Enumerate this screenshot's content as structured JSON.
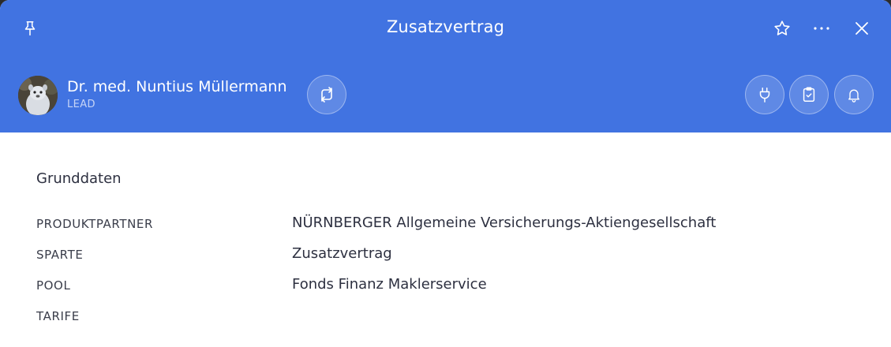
{
  "header": {
    "title": "Zusatzvertrag",
    "background_color": "#4173e1",
    "icons": [
      "pin-icon",
      "star-icon",
      "more-icon",
      "close-icon"
    ]
  },
  "person": {
    "name": "Dr. med. Nuntius Müllermann",
    "tag": "LEAD",
    "avatar_icon": "avatar-photo"
  },
  "actions": {
    "left": [
      "swap-icon"
    ],
    "right": [
      "plug-icon",
      "clipboard-check-icon",
      "bell-icon"
    ]
  },
  "section": {
    "title": "Grunddaten",
    "rows": [
      {
        "label": "PRODUKTPARTNER",
        "value": "NÜRNBERGER Allgemeine Versicherungs-Aktiengesellschaft"
      },
      {
        "label": "SPARTE",
        "value": "Zusatzvertrag"
      },
      {
        "label": "POOL",
        "value": "Fonds Finanz Maklerservice"
      },
      {
        "label": "TARIFE",
        "value": ""
      }
    ]
  }
}
